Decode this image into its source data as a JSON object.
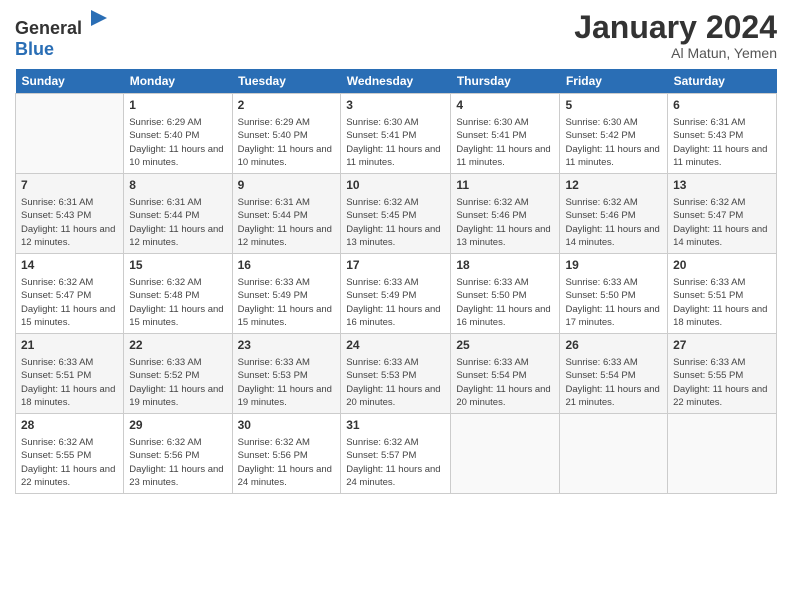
{
  "header": {
    "logo_general": "General",
    "logo_blue": "Blue",
    "month_year": "January 2024",
    "location": "Al Matun, Yemen"
  },
  "days_of_week": [
    "Sunday",
    "Monday",
    "Tuesday",
    "Wednesday",
    "Thursday",
    "Friday",
    "Saturday"
  ],
  "weeks": [
    [
      {
        "day": "",
        "sunrise": "",
        "sunset": "",
        "daylight": ""
      },
      {
        "day": "1",
        "sunrise": "Sunrise: 6:29 AM",
        "sunset": "Sunset: 5:40 PM",
        "daylight": "Daylight: 11 hours and 10 minutes."
      },
      {
        "day": "2",
        "sunrise": "Sunrise: 6:29 AM",
        "sunset": "Sunset: 5:40 PM",
        "daylight": "Daylight: 11 hours and 10 minutes."
      },
      {
        "day": "3",
        "sunrise": "Sunrise: 6:30 AM",
        "sunset": "Sunset: 5:41 PM",
        "daylight": "Daylight: 11 hours and 11 minutes."
      },
      {
        "day": "4",
        "sunrise": "Sunrise: 6:30 AM",
        "sunset": "Sunset: 5:41 PM",
        "daylight": "Daylight: 11 hours and 11 minutes."
      },
      {
        "day": "5",
        "sunrise": "Sunrise: 6:30 AM",
        "sunset": "Sunset: 5:42 PM",
        "daylight": "Daylight: 11 hours and 11 minutes."
      },
      {
        "day": "6",
        "sunrise": "Sunrise: 6:31 AM",
        "sunset": "Sunset: 5:43 PM",
        "daylight": "Daylight: 11 hours and 11 minutes."
      }
    ],
    [
      {
        "day": "7",
        "sunrise": "Sunrise: 6:31 AM",
        "sunset": "Sunset: 5:43 PM",
        "daylight": "Daylight: 11 hours and 12 minutes."
      },
      {
        "day": "8",
        "sunrise": "Sunrise: 6:31 AM",
        "sunset": "Sunset: 5:44 PM",
        "daylight": "Daylight: 11 hours and 12 minutes."
      },
      {
        "day": "9",
        "sunrise": "Sunrise: 6:31 AM",
        "sunset": "Sunset: 5:44 PM",
        "daylight": "Daylight: 11 hours and 12 minutes."
      },
      {
        "day": "10",
        "sunrise": "Sunrise: 6:32 AM",
        "sunset": "Sunset: 5:45 PM",
        "daylight": "Daylight: 11 hours and 13 minutes."
      },
      {
        "day": "11",
        "sunrise": "Sunrise: 6:32 AM",
        "sunset": "Sunset: 5:46 PM",
        "daylight": "Daylight: 11 hours and 13 minutes."
      },
      {
        "day": "12",
        "sunrise": "Sunrise: 6:32 AM",
        "sunset": "Sunset: 5:46 PM",
        "daylight": "Daylight: 11 hours and 14 minutes."
      },
      {
        "day": "13",
        "sunrise": "Sunrise: 6:32 AM",
        "sunset": "Sunset: 5:47 PM",
        "daylight": "Daylight: 11 hours and 14 minutes."
      }
    ],
    [
      {
        "day": "14",
        "sunrise": "Sunrise: 6:32 AM",
        "sunset": "Sunset: 5:47 PM",
        "daylight": "Daylight: 11 hours and 15 minutes."
      },
      {
        "day": "15",
        "sunrise": "Sunrise: 6:32 AM",
        "sunset": "Sunset: 5:48 PM",
        "daylight": "Daylight: 11 hours and 15 minutes."
      },
      {
        "day": "16",
        "sunrise": "Sunrise: 6:33 AM",
        "sunset": "Sunset: 5:49 PM",
        "daylight": "Daylight: 11 hours and 15 minutes."
      },
      {
        "day": "17",
        "sunrise": "Sunrise: 6:33 AM",
        "sunset": "Sunset: 5:49 PM",
        "daylight": "Daylight: 11 hours and 16 minutes."
      },
      {
        "day": "18",
        "sunrise": "Sunrise: 6:33 AM",
        "sunset": "Sunset: 5:50 PM",
        "daylight": "Daylight: 11 hours and 16 minutes."
      },
      {
        "day": "19",
        "sunrise": "Sunrise: 6:33 AM",
        "sunset": "Sunset: 5:50 PM",
        "daylight": "Daylight: 11 hours and 17 minutes."
      },
      {
        "day": "20",
        "sunrise": "Sunrise: 6:33 AM",
        "sunset": "Sunset: 5:51 PM",
        "daylight": "Daylight: 11 hours and 18 minutes."
      }
    ],
    [
      {
        "day": "21",
        "sunrise": "Sunrise: 6:33 AM",
        "sunset": "Sunset: 5:51 PM",
        "daylight": "Daylight: 11 hours and 18 minutes."
      },
      {
        "day": "22",
        "sunrise": "Sunrise: 6:33 AM",
        "sunset": "Sunset: 5:52 PM",
        "daylight": "Daylight: 11 hours and 19 minutes."
      },
      {
        "day": "23",
        "sunrise": "Sunrise: 6:33 AM",
        "sunset": "Sunset: 5:53 PM",
        "daylight": "Daylight: 11 hours and 19 minutes."
      },
      {
        "day": "24",
        "sunrise": "Sunrise: 6:33 AM",
        "sunset": "Sunset: 5:53 PM",
        "daylight": "Daylight: 11 hours and 20 minutes."
      },
      {
        "day": "25",
        "sunrise": "Sunrise: 6:33 AM",
        "sunset": "Sunset: 5:54 PM",
        "daylight": "Daylight: 11 hours and 20 minutes."
      },
      {
        "day": "26",
        "sunrise": "Sunrise: 6:33 AM",
        "sunset": "Sunset: 5:54 PM",
        "daylight": "Daylight: 11 hours and 21 minutes."
      },
      {
        "day": "27",
        "sunrise": "Sunrise: 6:33 AM",
        "sunset": "Sunset: 5:55 PM",
        "daylight": "Daylight: 11 hours and 22 minutes."
      }
    ],
    [
      {
        "day": "28",
        "sunrise": "Sunrise: 6:32 AM",
        "sunset": "Sunset: 5:55 PM",
        "daylight": "Daylight: 11 hours and 22 minutes."
      },
      {
        "day": "29",
        "sunrise": "Sunrise: 6:32 AM",
        "sunset": "Sunset: 5:56 PM",
        "daylight": "Daylight: 11 hours and 23 minutes."
      },
      {
        "day": "30",
        "sunrise": "Sunrise: 6:32 AM",
        "sunset": "Sunset: 5:56 PM",
        "daylight": "Daylight: 11 hours and 24 minutes."
      },
      {
        "day": "31",
        "sunrise": "Sunrise: 6:32 AM",
        "sunset": "Sunset: 5:57 PM",
        "daylight": "Daylight: 11 hours and 24 minutes."
      },
      {
        "day": "",
        "sunrise": "",
        "sunset": "",
        "daylight": ""
      },
      {
        "day": "",
        "sunrise": "",
        "sunset": "",
        "daylight": ""
      },
      {
        "day": "",
        "sunrise": "",
        "sunset": "",
        "daylight": ""
      }
    ]
  ]
}
